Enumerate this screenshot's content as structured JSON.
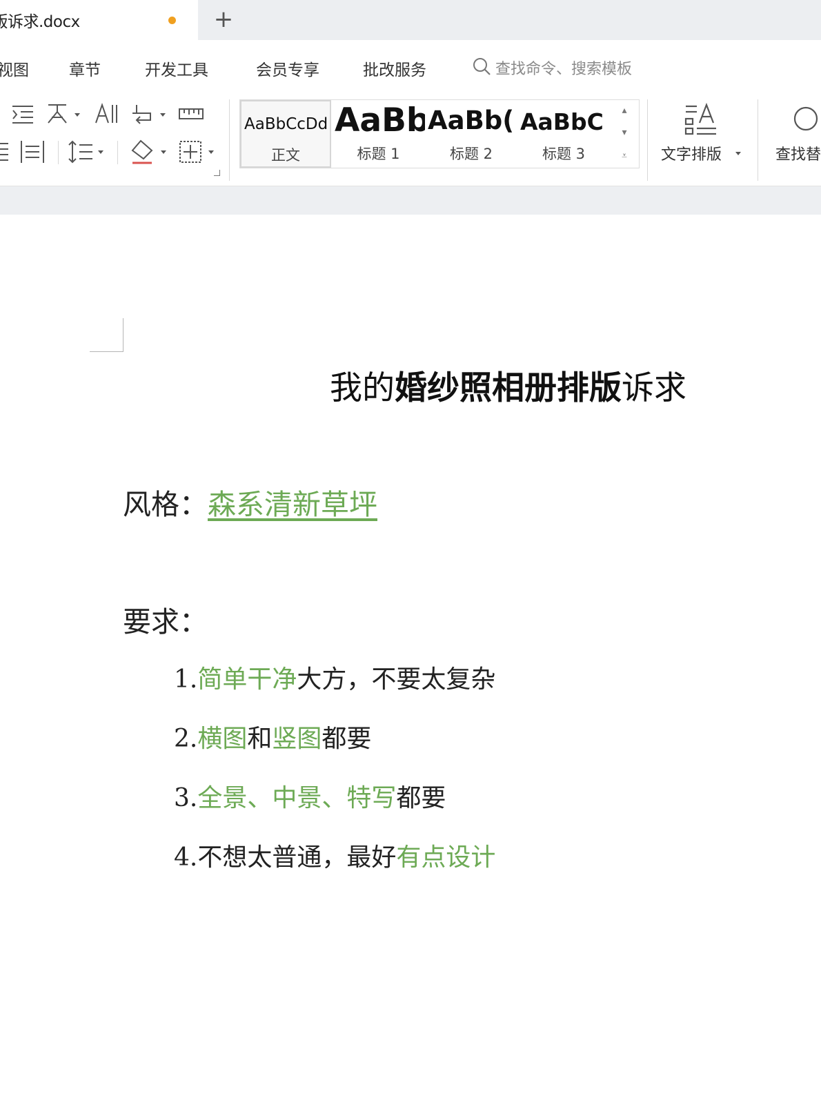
{
  "tab": {
    "title": "排版诉求.docx",
    "new_tab": "+"
  },
  "menu": {
    "items": [
      "视图",
      "章节",
      "开发工具",
      "会员专享",
      "批改服务"
    ],
    "search_placeholder": "查找命令、搜索模板"
  },
  "ribbon": {
    "styles": [
      {
        "sample": "AaBbCcDd",
        "label": "正文"
      },
      {
        "sample": "AaBb",
        "label": "标题 1"
      },
      {
        "sample": "AaBb(",
        "label": "标题 2"
      },
      {
        "sample": "AaBbC",
        "label": "标题 3"
      }
    ],
    "text_layout": "文字排版",
    "find_replace": "查找替"
  },
  "document": {
    "title_pre": "我的",
    "title_bold": "婚纱照相册排版",
    "title_post": "诉求",
    "style_label": "风格：",
    "style_value": "森系清新草坪",
    "req_label": "要求：",
    "req1_num": "1.",
    "req1_green": "简单干净",
    "req1_rest": "大方，不要太复杂",
    "req2_num": "2.",
    "req2_g1": "横图",
    "req2_mid": "和",
    "req2_g2": "竖图",
    "req2_end": "都要",
    "req3_num": "3.",
    "req3_green": "全景、中景、特写",
    "req3_end": "都要",
    "req4_num": "4.",
    "req4_text": "不想太普通，最好",
    "req4_green": "有点设计"
  },
  "colors": {
    "accent_green": "#6daa55",
    "unsaved_dot": "#f0a020"
  }
}
